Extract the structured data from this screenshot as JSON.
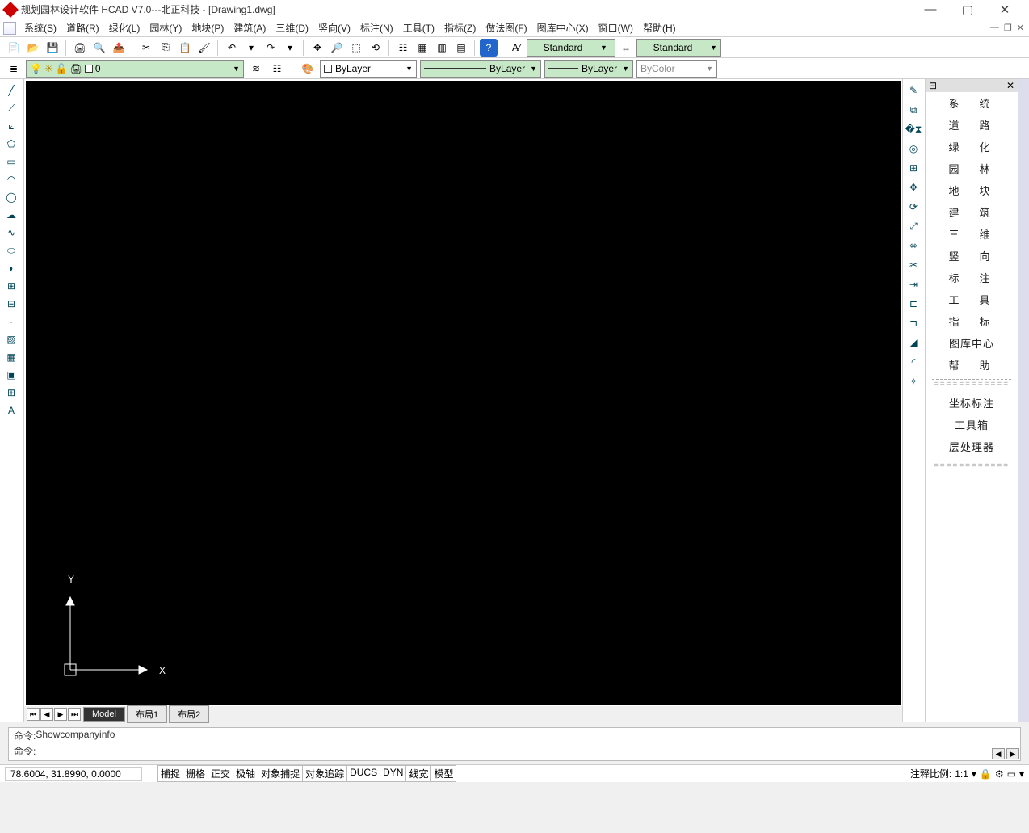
{
  "title": "规划园林设计软件 HCAD V7.0---北正科技 - [Drawing1.dwg]",
  "menus": [
    "系统(S)",
    "道路(R)",
    "绿化(L)",
    "园林(Y)",
    "地块(P)",
    "建筑(A)",
    "三维(D)",
    "竖向(V)",
    "标注(N)",
    "工具(T)",
    "指标(Z)",
    "做法图(F)",
    "图库中心(X)",
    "窗口(W)",
    "帮助(H)"
  ],
  "toolbar1": {
    "style1": "Standard",
    "style2": "Standard"
  },
  "toolbar2": {
    "layer_name": "0",
    "color_combo": "ByLayer",
    "linetype": "ByLayer",
    "lineweight": "ByLayer",
    "plotstyle": "ByColor"
  },
  "tabs": {
    "model": "Model",
    "layout1": "布局1",
    "layout2": "布局2"
  },
  "ucs": {
    "x": "X",
    "y": "Y"
  },
  "right_panel": {
    "items": [
      "系　统",
      "道　路",
      "绿　化",
      "园　林",
      "地　块",
      "建　筑",
      "三　维",
      "竖　向",
      "标　注",
      "工　具",
      "指　标",
      "图库中心",
      "帮　助"
    ],
    "items2": [
      "坐标标注",
      "工具箱",
      "层处理器"
    ]
  },
  "cmd": {
    "label": "命令: ",
    "line1": "Showcompanyinfo",
    "line2": ""
  },
  "status": {
    "coords": "78.6004, 31.8990, 0.0000",
    "toggles": [
      "捕捉",
      "栅格",
      "正交",
      "极轴",
      "对象捕捉",
      "对象追踪",
      "DUCS",
      "DYN",
      "线宽",
      "模型"
    ],
    "anno_label": "注释比例:",
    "anno_value": "1:1"
  }
}
